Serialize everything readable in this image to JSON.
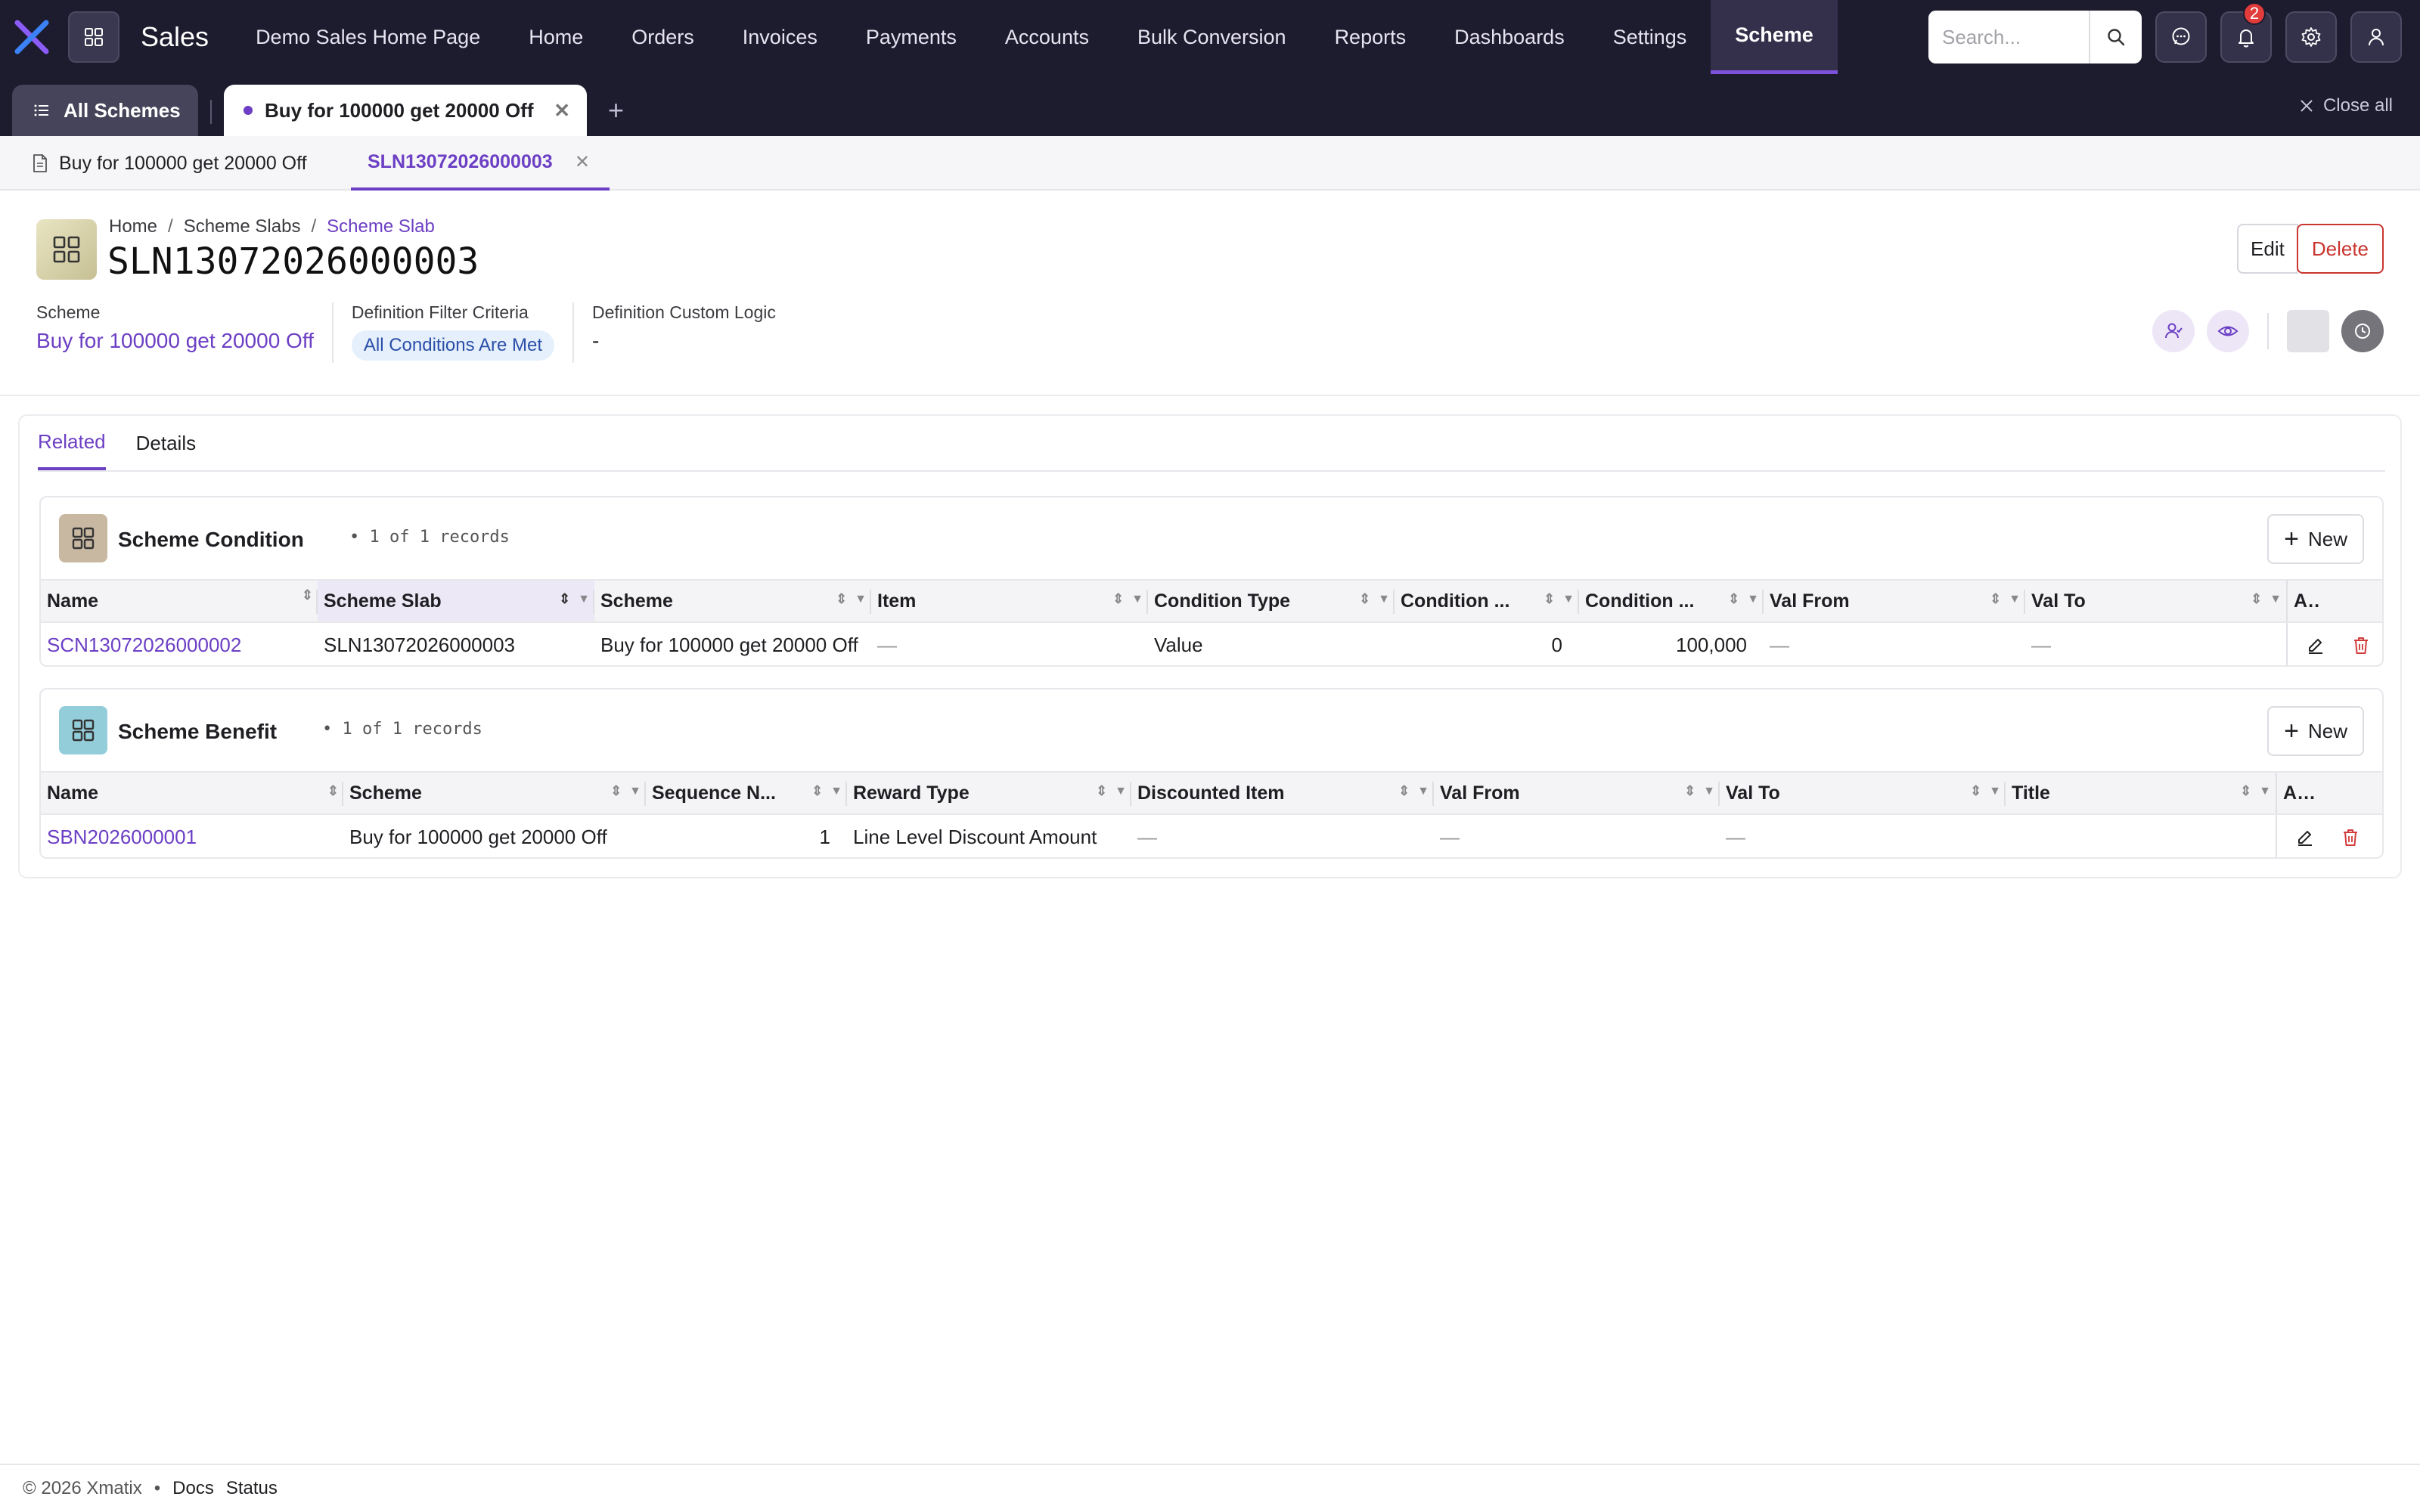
{
  "app": {
    "name": "Sales"
  },
  "nav": {
    "items": [
      "Demo Sales Home Page",
      "Home",
      "Orders",
      "Invoices",
      "Payments",
      "Accounts",
      "Bulk Conversion",
      "Reports",
      "Dashboards",
      "Settings",
      "Scheme"
    ],
    "active": "Scheme",
    "search_placeholder": "Search...",
    "notification_count": "2"
  },
  "tabs": {
    "all_label": "All Schemes",
    "current_label": "Buy for 100000 get 20000 Off",
    "close_all": "Close all"
  },
  "subtabs": {
    "first": "Buy for 100000 get 20000 Off",
    "second": "SLN13072026000003"
  },
  "breadcrumb": [
    "Home",
    "Scheme Slabs",
    "Scheme Slab"
  ],
  "record": {
    "title": "SLN13072026000003",
    "edit_label": "Edit",
    "delete_label": "Delete",
    "fields": {
      "scheme_label": "Scheme",
      "scheme_value": "Buy for 100000 get 20000 Off",
      "filter_label": "Definition Filter Criteria",
      "filter_value": "All Conditions Are Met",
      "logic_label": "Definition Custom Logic",
      "logic_value": "-"
    }
  },
  "content_tabs": [
    "Related",
    "Details"
  ],
  "condition": {
    "title": "Scheme Condition",
    "count": "• 1 of 1 records",
    "new_label": "New",
    "columns": [
      "Name",
      "Scheme Slab",
      "Scheme",
      "Item",
      "Condition Type",
      "Condition ...",
      "Condition ...",
      "Val From",
      "Val To",
      "Actions"
    ],
    "row": {
      "name": "SCN13072026000002",
      "slab": "SLN13072026000003",
      "scheme": "Buy for 100000 get 20000 Off",
      "item": "—",
      "type": "Value",
      "cond1": "0",
      "cond2": "100,000",
      "val_from": "—",
      "val_to": "—"
    }
  },
  "benefit": {
    "title": "Scheme Benefit",
    "count": "• 1 of 1 records",
    "new_label": "New",
    "columns": [
      "Name",
      "Scheme",
      "Sequence N...",
      "Reward Type",
      "Discounted Item",
      "Val From",
      "Val To",
      "Title",
      "Actions"
    ],
    "row": {
      "name": "SBN2026000001",
      "scheme": "Buy for 100000 get 20000 Off",
      "sequence": "1",
      "reward_type": "Line Level Discount Amount",
      "discounted_item": "—",
      "val_from": "—",
      "val_to": "—",
      "title": ""
    }
  },
  "footer": {
    "copyright": "© 2026 Xmatix",
    "bullet": "•",
    "docs": "Docs",
    "status": "Status"
  },
  "colors": {
    "accent": "#6c3fc4",
    "nav_bg": "#1d1b2e",
    "danger": "#c9352f"
  }
}
